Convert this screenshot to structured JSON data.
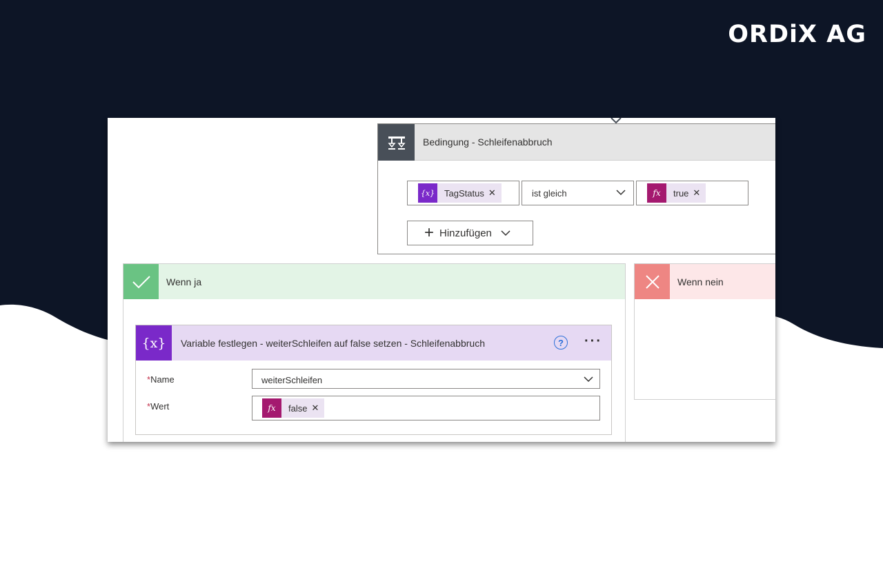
{
  "brand": {
    "name": "ORDiX AG"
  },
  "condition": {
    "title": "Bedingung - Schleifenabbruch",
    "left_operand": {
      "label": "TagStatus",
      "icon": "variable-icon",
      "color": "#7a29c9"
    },
    "operator": "ist gleich",
    "right_operand": {
      "label": "true",
      "icon": "fx-icon",
      "color": "#a4196f"
    },
    "add_button": "Hinzufügen"
  },
  "branches": {
    "yes": {
      "title": "Wenn ja",
      "color": "#6ac383"
    },
    "no": {
      "title": "Wenn nein",
      "color": "#ee8683"
    }
  },
  "action": {
    "title": "Variable festlegen - weiterSchleifen auf false setzen - Schleifenabbruch",
    "icon_text": "{x}",
    "help": "?",
    "more": "···",
    "name_label": "Name",
    "name_value": "weiterSchleifen",
    "value_label": "Wert",
    "value_token": {
      "label": "false",
      "icon": "fx-icon",
      "color": "#a4196f"
    },
    "required_mark": "*"
  },
  "colors": {
    "dark_bg": "#0d1526",
    "variable_purple": "#7a29c9",
    "expression_magenta": "#a4196f"
  }
}
